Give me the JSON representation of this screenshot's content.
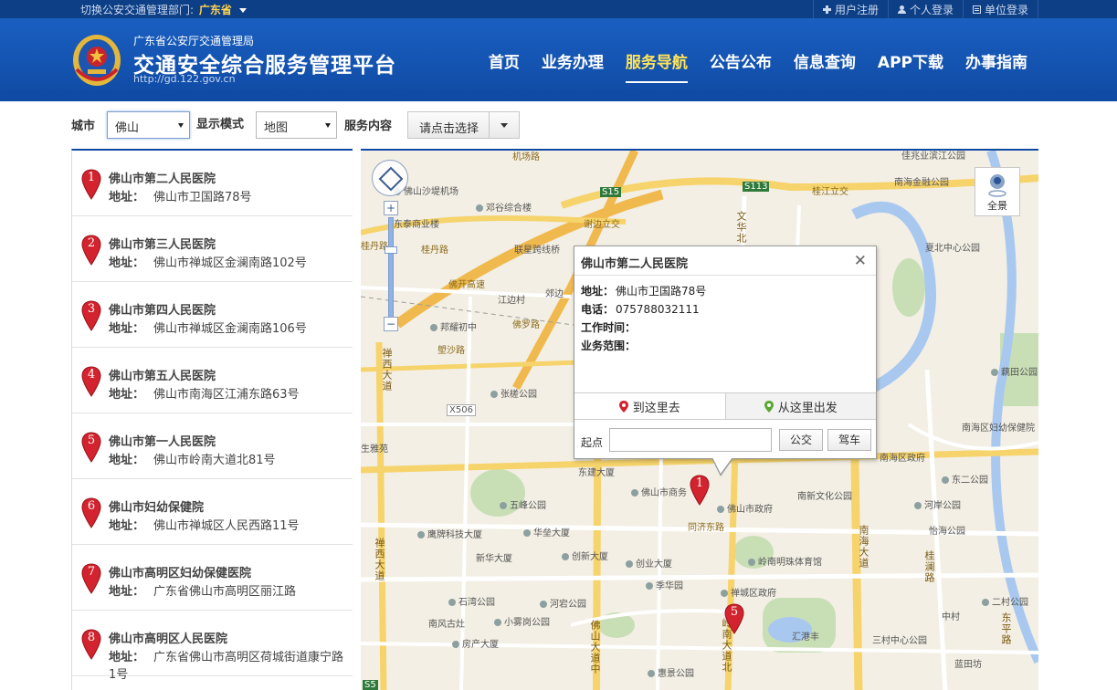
{
  "topbar": {
    "switch_label": "切换公安交通管理部门:",
    "province": "广东省",
    "links": [
      {
        "icon": "plus-icon",
        "label": "用户注册"
      },
      {
        "icon": "user-icon",
        "label": "个人登录"
      },
      {
        "icon": "document-icon",
        "label": "单位登录"
      }
    ]
  },
  "header": {
    "subtitle": "广东省公安厅交通管理局",
    "title": "交通安全综合服务管理平台",
    "url": "http://gd.122.gov.cn",
    "nav": [
      {
        "label": "首页",
        "active": false
      },
      {
        "label": "业务办理",
        "active": false
      },
      {
        "label": "服务导航",
        "active": true
      },
      {
        "label": "公告公布",
        "active": false
      },
      {
        "label": "信息查询",
        "active": false
      },
      {
        "label": "APP下载",
        "active": false
      },
      {
        "label": "办事指南",
        "active": false
      }
    ]
  },
  "filters": {
    "city_label": "城市",
    "city_value": "佛山",
    "mode_label": "显示模式",
    "mode_value": "地图",
    "service_label": "服务内容",
    "service_value": "请点击选择"
  },
  "list": {
    "addr_label": "地址：",
    "items": [
      {
        "num": "1",
        "name": "佛山市第二人民医院",
        "address": "佛山市卫国路78号"
      },
      {
        "num": "2",
        "name": "佛山市第三人民医院",
        "address": "佛山市禅城区金澜南路102号"
      },
      {
        "num": "3",
        "name": "佛山市第四人民医院",
        "address": "佛山市禅城区金澜南路106号"
      },
      {
        "num": "4",
        "name": "佛山市第五人民医院",
        "address": "佛山市南海区江浦东路63号"
      },
      {
        "num": "5",
        "name": "佛山市第一人民医院",
        "address": "佛山市岭南大道北81号"
      },
      {
        "num": "6",
        "name": "佛山市妇幼保健院",
        "address": "佛山市禅城区人民西路11号"
      },
      {
        "num": "7",
        "name": "佛山市高明区妇幼保健医院",
        "address": "广东省佛山市高明区丽江路"
      },
      {
        "num": "8",
        "name": "佛山市高明区人民医院",
        "address": "广东省佛山市高明区荷城街道康宁路1号"
      }
    ]
  },
  "map": {
    "overview_label": "全景",
    "labels": {
      "l1": "机场路",
      "l2": "佛山沙堤机场",
      "l3": "邓谷综合楼",
      "l4": "东泰商业楼",
      "l5": "桂丹路",
      "l6": "谢边立交",
      "l7": "桂丹路",
      "l8": "联星跨线桥",
      "l9": "佛开高速",
      "l10": "江边村",
      "l11": "郊边",
      "l12": "邦耀初中",
      "l13": "佛罗路",
      "l14": "塱沙路",
      "l15": "张槎公园",
      "l16": "生雅苑",
      "l17": "东建大厦",
      "l18": "佛山市商务",
      "l19": "佛山市政府",
      "l20": "同济东路",
      "l21": "五峰公园",
      "l22": "鹰牌科技大厦",
      "l23": "华垒大厦",
      "l24": "新华大厦",
      "l25": "创新大厦",
      "l26": "创业大厦",
      "l27": "季华园",
      "l28": "岭南明珠体育馆",
      "l29": "禅城区政府",
      "l30": "石湾公园",
      "l31": "河宕公园",
      "l32": "南风古灶",
      "l33": "小雾岗公园",
      "l34": "房产大厦",
      "l35": "惠景公园",
      "l36": "汇港丰",
      "l37": "桂江立交",
      "l38": "南海金融公园",
      "l39": "佳兆业滨江公园",
      "l40": "夏北中心公园",
      "l41": "藕田公园",
      "l42": "南海区妇幼保健院",
      "l43": "东二公园",
      "l44": "南海区政府",
      "l45": "南新文化公园",
      "l46": "河岸公园",
      "l47": "怡海公园",
      "l48": "二村公园",
      "l49": "三村中心公园",
      "l50": "蓝田坊",
      "l51": "中村",
      "v1": "禅西大道",
      "v2": "文华北",
      "v3": "禅西大道",
      "v4": "佛山大道中",
      "v5": "岭南大道北",
      "v6": "南海大道",
      "v7": "桂澜路",
      "v8": "东平路",
      "s1": "S15",
      "s2": "S113",
      "s3": "X506",
      "s4": "S5"
    }
  },
  "popup": {
    "title": "佛山市第二人民医院",
    "addr_label": "地址：",
    "addr": "佛山市卫国路78号",
    "phone_label": "电话：",
    "phone": "075788032111",
    "hours_label": "工作时间：",
    "scope_label": "业务范围：",
    "tab_to": "到这里去",
    "tab_from": "从这里出发",
    "start_label": "起点",
    "btn_bus": "公交",
    "btn_car": "驾车",
    "pin_num": "1",
    "pin2_num": "5"
  },
  "colors": {
    "header_blue": "#0f4aa3",
    "nav_active": "#ffe35a",
    "pin_red": "#d2232e"
  }
}
